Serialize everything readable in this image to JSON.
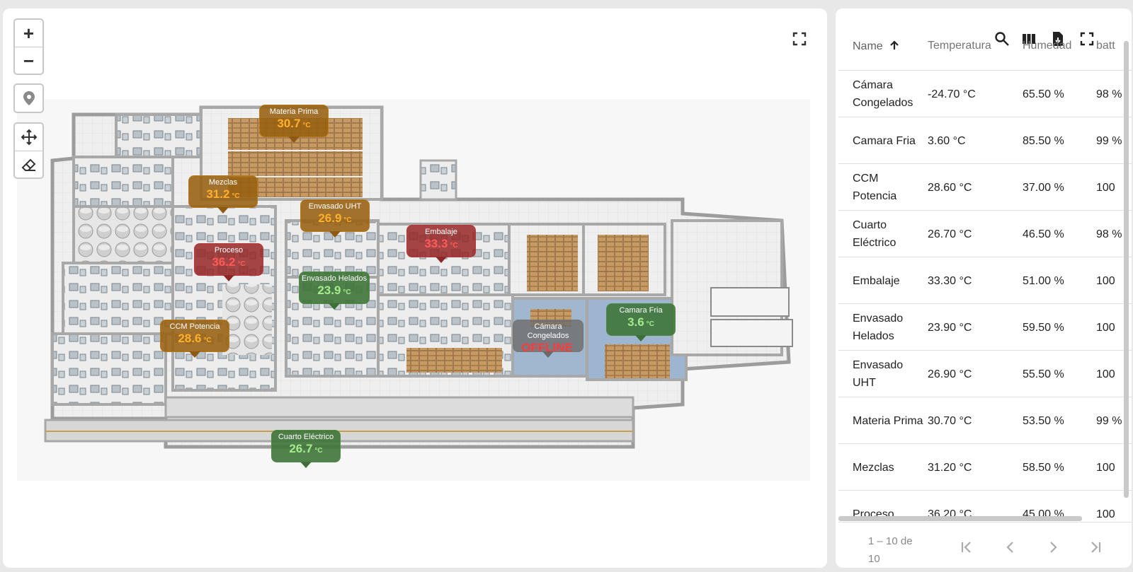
{
  "map": {
    "zoom_in_label": "+",
    "zoom_out_label": "−",
    "icons": [
      "plus-icon",
      "minus-icon",
      "map-pin-icon",
      "move-icon",
      "eraser-icon",
      "fullscreen-icon"
    ],
    "markers": [
      {
        "name": "Materia Prima",
        "value": "30.7",
        "unit": "°C",
        "status": "warning"
      },
      {
        "name": "Mezclas",
        "value": "31.2",
        "unit": "°C",
        "status": "warning"
      },
      {
        "name": "Envasado UHT",
        "value": "26.9",
        "unit": "°C",
        "status": "warning"
      },
      {
        "name": "Embalaje",
        "value": "33.3",
        "unit": "°C",
        "status": "critical"
      },
      {
        "name": "Proceso",
        "value": "36.2",
        "unit": "°C",
        "status": "critical"
      },
      {
        "name": "Envasado Helados",
        "value": "23.9",
        "unit": "°C",
        "status": "ok"
      },
      {
        "name": "Camara Fria",
        "value": "3.6",
        "unit": "°C",
        "status": "ok"
      },
      {
        "name": "Cámara Congelados",
        "value": "OFFLINE",
        "unit": "",
        "status": "offline"
      },
      {
        "name": "CCM Potencia",
        "value": "28.6",
        "unit": "°C",
        "status": "warning"
      },
      {
        "name": "Cuarto Eléctrico",
        "value": "26.7",
        "unit": "°C",
        "status": "ok"
      }
    ],
    "colors": {
      "warning": "#ffb02b",
      "critical": "#ff5a5a",
      "ok": "#a6ea8e",
      "offline": "#ff3b3b"
    }
  },
  "table": {
    "columns": {
      "name": "Name",
      "temp": "Temperatura",
      "hum": "Humedad",
      "bat": "batt"
    },
    "sort_icon": "arrow-up-icon",
    "toolbar_icons": [
      "search-icon",
      "columns-icon",
      "export-file-icon",
      "fullscreen-icon"
    ],
    "rows": [
      {
        "name": "Cámara Congelados",
        "temp": "-24.70 °C",
        "hum": "65.50 %",
        "bat": "98 %"
      },
      {
        "name": "Camara Fria",
        "temp": "3.60 °C",
        "hum": "85.50 %",
        "bat": "99 %"
      },
      {
        "name": "CCM Potencia",
        "temp": "28.60 °C",
        "hum": "37.00 %",
        "bat": "100"
      },
      {
        "name": "Cuarto Eléctrico",
        "temp": "26.70 °C",
        "hum": "46.50 %",
        "bat": "98 %"
      },
      {
        "name": "Embalaje",
        "temp": "33.30 °C",
        "hum": "51.00 %",
        "bat": "100"
      },
      {
        "name": "Envasado Helados",
        "temp": "23.90 °C",
        "hum": "59.50 %",
        "bat": "100"
      },
      {
        "name": "Envasado UHT",
        "temp": "26.90 °C",
        "hum": "55.50 %",
        "bat": "100"
      },
      {
        "name": "Materia Prima",
        "temp": "30.70 °C",
        "hum": "53.50 %",
        "bat": "99 %"
      },
      {
        "name": "Mezclas",
        "temp": "31.20 °C",
        "hum": "58.50 %",
        "bat": "100"
      },
      {
        "name": "Proceso",
        "temp": "36.20 °C",
        "hum": "45.00 %",
        "bat": "100"
      }
    ],
    "pagination": {
      "range": "1 – 10 de 10",
      "icons": [
        "first-page-icon",
        "prev-page-icon",
        "next-page-icon",
        "last-page-icon"
      ]
    }
  }
}
